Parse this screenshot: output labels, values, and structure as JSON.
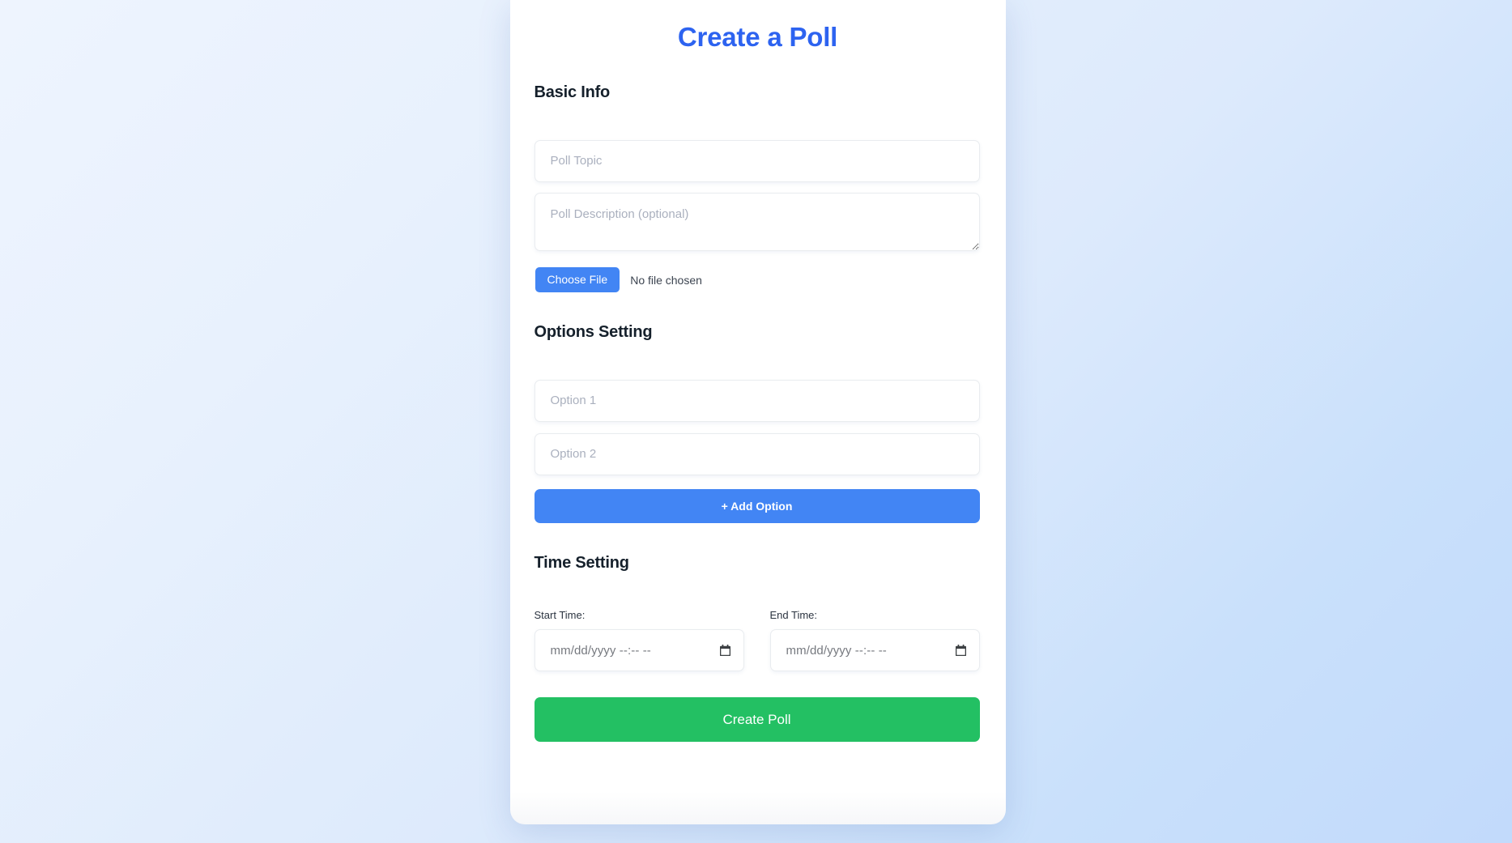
{
  "page": {
    "title": "Create a Poll",
    "accent_color": "#2d63f0",
    "button_blue": "#4285f4",
    "button_green": "#23c063",
    "background_from": "#eef4fe",
    "background_to": "#c2dafb"
  },
  "basic_info": {
    "heading": "Basic Info",
    "topic_placeholder": "Poll Topic",
    "topic_value": "",
    "description_placeholder": "Poll Description (optional)",
    "description_value": "",
    "file": {
      "button_label": "Choose File",
      "status_text": "No file chosen"
    }
  },
  "options_setting": {
    "heading": "Options Setting",
    "options": [
      {
        "placeholder": "Option 1",
        "value": ""
      },
      {
        "placeholder": "Option 2",
        "value": ""
      }
    ],
    "add_option_label": "+ Add Option"
  },
  "time_setting": {
    "heading": "Time Setting",
    "start": {
      "label": "Start Time:",
      "placeholder": "mm/dd/yyyy --:-- --",
      "value": "",
      "icon": "calendar-icon"
    },
    "end": {
      "label": "End Time:",
      "placeholder": "mm/dd/yyyy --:-- --",
      "value": "",
      "icon": "calendar-icon"
    }
  },
  "submit": {
    "label": "Create Poll"
  }
}
